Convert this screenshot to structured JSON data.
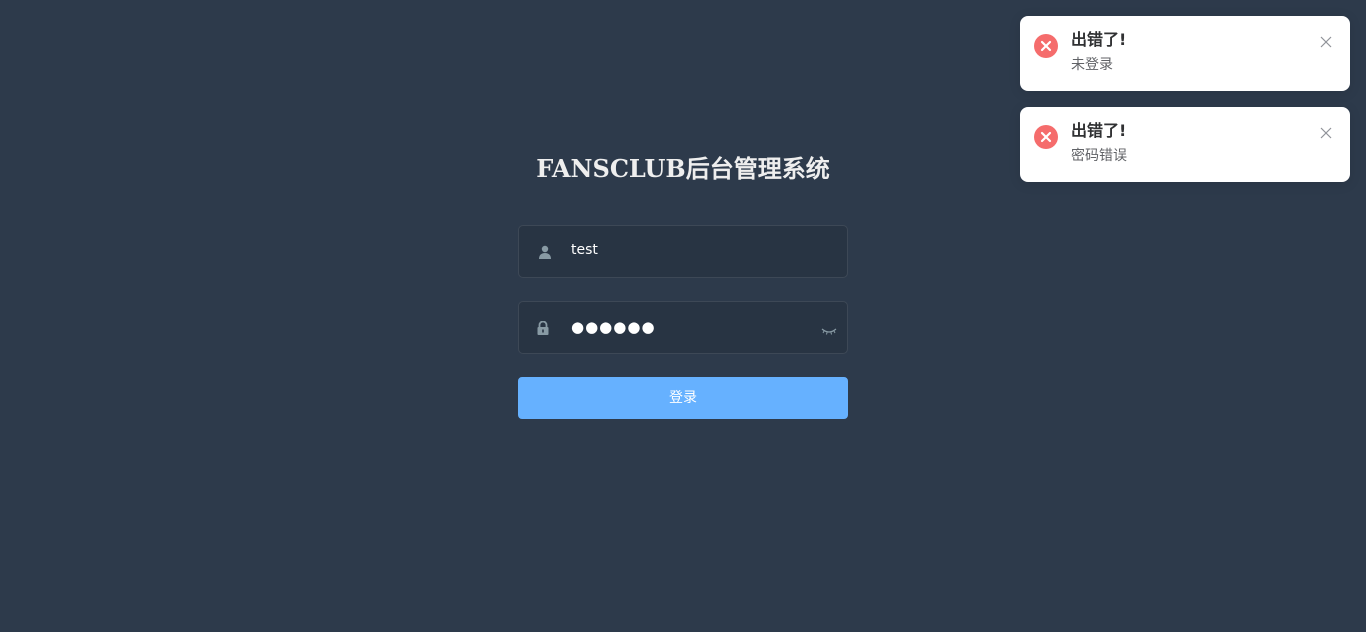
{
  "login": {
    "title": "FANSCLUB后台管理系统",
    "username_value": "test",
    "password_value": "●●●●●●",
    "submit_label": "登录"
  },
  "notifications": [
    {
      "title": "出错了!",
      "message": "未登录",
      "type": "error"
    },
    {
      "title": "出错了!",
      "message": "密码错误",
      "type": "error"
    }
  ],
  "icons": {
    "user": "user-icon",
    "lock": "lock-icon",
    "eye": "eye-closed-icon",
    "error": "error-circle-icon",
    "close": "close-icon"
  },
  "colors": {
    "background": "#2d3a4b",
    "input_background": "#283443",
    "primary_button": "#66b1ff",
    "error": "#f56c6c"
  }
}
